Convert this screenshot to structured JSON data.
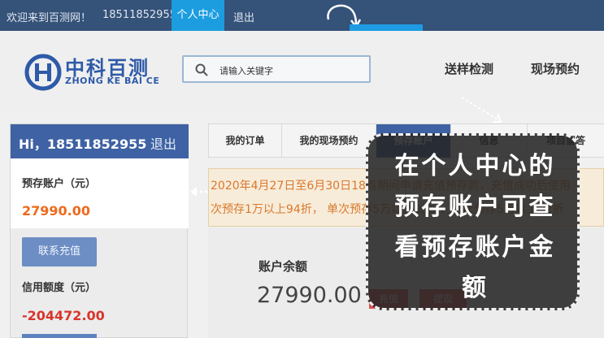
{
  "topbar": {
    "welcome": "欢迎来到百测网！",
    "phone": "18511852955",
    "center_link": "个人中心",
    "logout": "退出"
  },
  "popup": {
    "prepay_label": "预存账户"
  },
  "header": {
    "logo_cn": "中科百测",
    "logo_en": "ZHONG KE BAI CE",
    "search_placeholder": "请输入关键字",
    "nav": [
      "送样检测",
      "现场预约"
    ]
  },
  "sidebar": {
    "greeting": "Hi，18511852955",
    "exit": "退出",
    "account_label": "预存账户（元）",
    "account_value": "27990.00",
    "recharge_button": "联系充值",
    "credit_label": "信用额度（元）",
    "credit_value": "-204472.00"
  },
  "tabs": [
    "我的订单",
    "我的现场预约",
    "预存账户",
    "信息",
    "项目留答"
  ],
  "notice": {
    "line1": "2020年4月27日至6月30日18点期间申请充值预存款，充值成功后使用",
    "line2": "次预存1万以上94折， 单次预存5万以上93折，单次预存5万以上92折"
  },
  "balance": {
    "label": "账户余额",
    "value": "27990.00",
    "charge_button": "充值",
    "withdraw_button": "提现"
  },
  "callout": {
    "lines": [
      "在个人中心的",
      "预存账户可查",
      "看预存账户金",
      "额"
    ]
  },
  "colors": {
    "topbar_bg": "#355279",
    "accent_blue": "#1b9de0",
    "sidebar_header": "#3e62a3",
    "amount_orange": "#ee6a1c",
    "amount_red": "#d8352b",
    "button_red": "#d9534f"
  }
}
